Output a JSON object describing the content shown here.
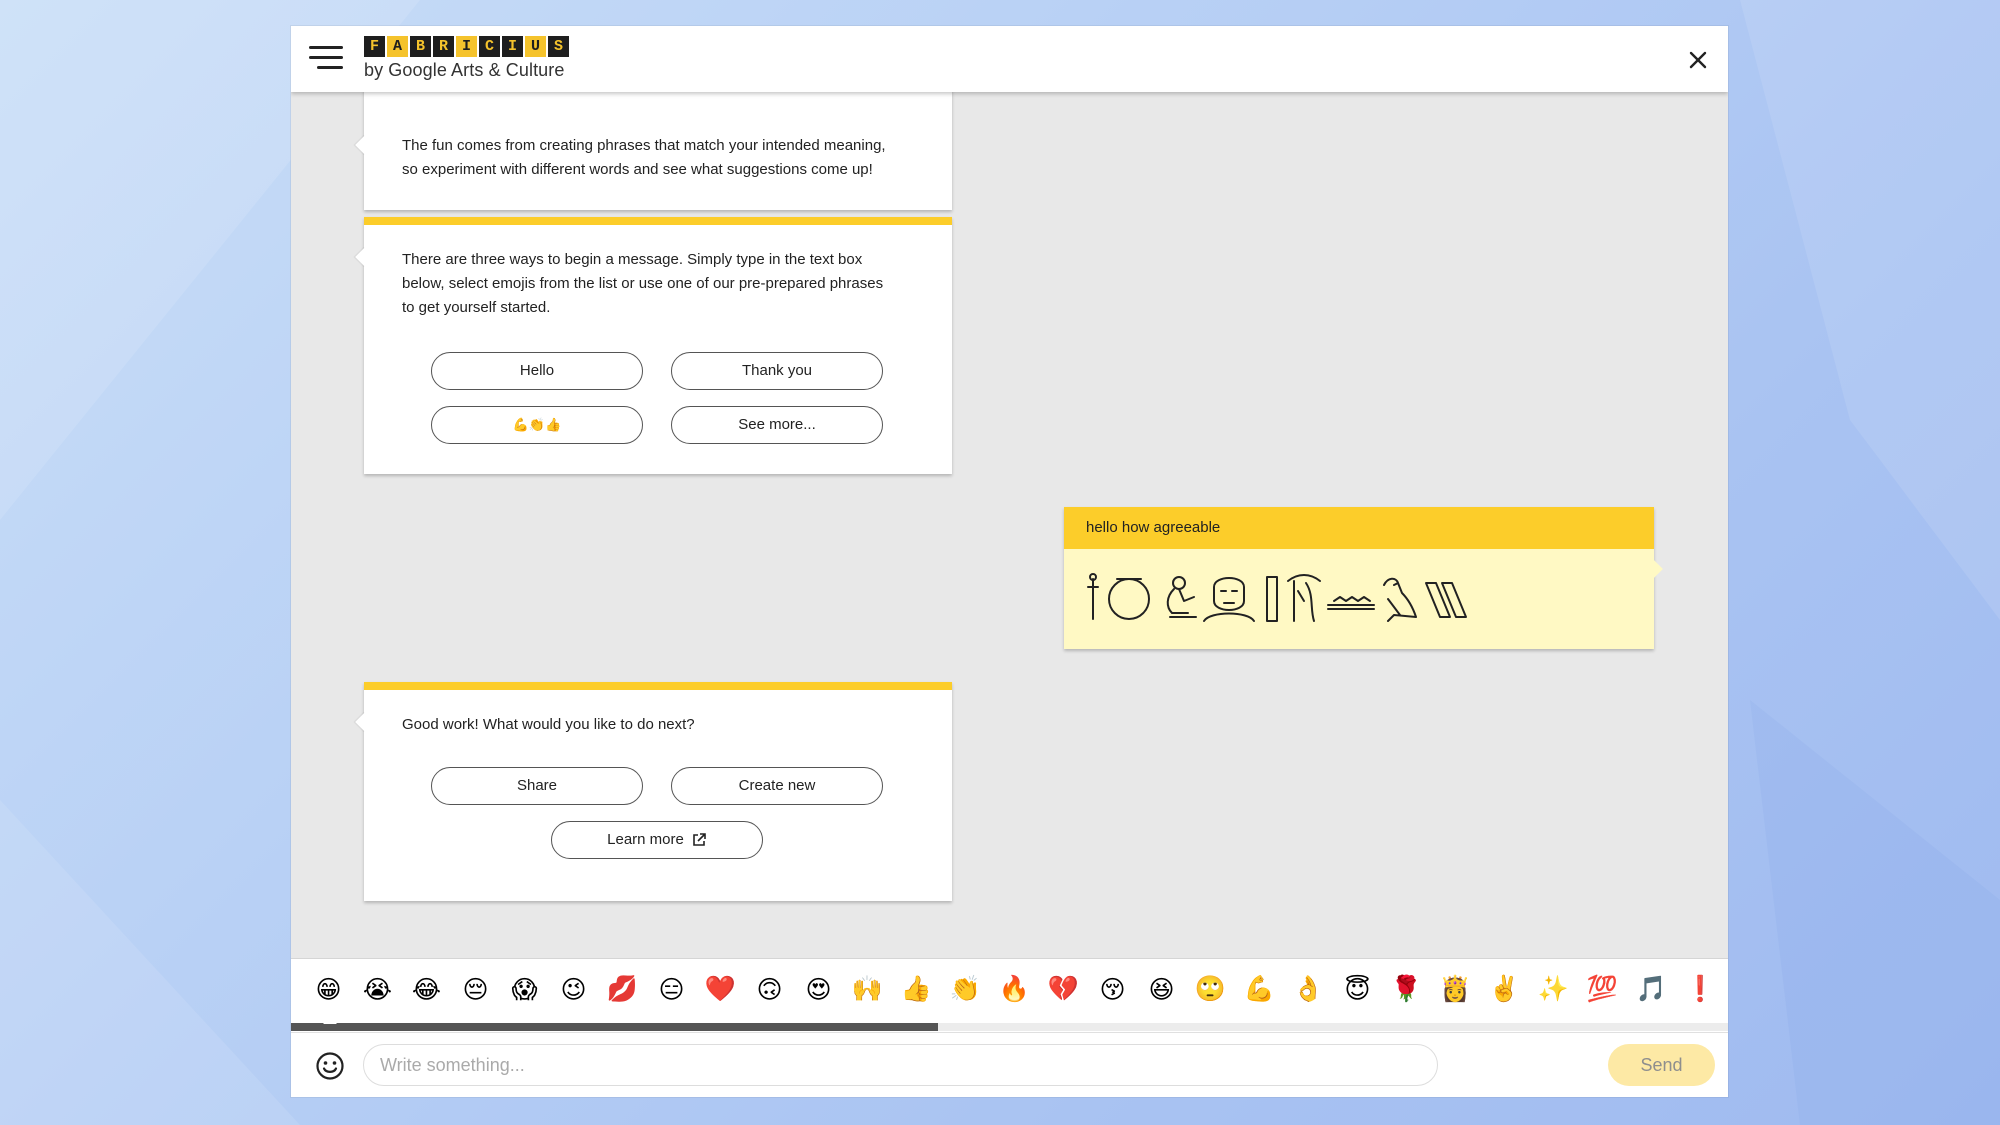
{
  "header": {
    "logo_letters": [
      "F",
      "A",
      "B",
      "R",
      "I",
      "C",
      "I",
      "U",
      "S"
    ],
    "logo_subtitle": "by Google Arts & Culture"
  },
  "cards": {
    "intro_tip": {
      "line1": "The fun comes from creating phrases that match your intended meaning,",
      "line2": "so experiment with different words and see what suggestions come up!"
    },
    "start": {
      "line1": "There are three ways to begin a message. Simply type in the text box",
      "line2": "below, select emojis from the list or use one of our pre-prepared phrases",
      "line3": "to get yourself started.",
      "buttons": [
        "Hello",
        "Thank you",
        "💪👏👍",
        "See more..."
      ]
    },
    "next": {
      "prompt": "Good work! What would you like to do next?",
      "buttons": [
        "Share",
        "Create new",
        "Learn more"
      ]
    }
  },
  "user_message": {
    "text": "hello how agreeable",
    "hieroglyphs": [
      "sceptre",
      "ring",
      "seated-man",
      "face",
      "reed",
      "bow",
      "water",
      "vulture",
      "strokes"
    ]
  },
  "emoji_bar": {
    "emojis": [
      "😁",
      "😭",
      "😂",
      "😔",
      "😱",
      "😉",
      "💋",
      "😑",
      "❤️",
      "🙃",
      "😍",
      "🙌",
      "👍",
      "👏",
      "🔥",
      "💔",
      "😚",
      "😆",
      "🙄",
      "💪",
      "👌",
      "😇",
      "🌹",
      "👸",
      "✌️",
      "✨",
      "💯",
      "🎵",
      "❗"
    ],
    "scroll_position": 0.45
  },
  "composer": {
    "placeholder": "Write something...",
    "value": "",
    "send_label": "Send"
  },
  "colors": {
    "accent_yellow": "#fccd2a",
    "user_bubble": "#fff9c4",
    "chat_background": "#e8e8e8"
  }
}
